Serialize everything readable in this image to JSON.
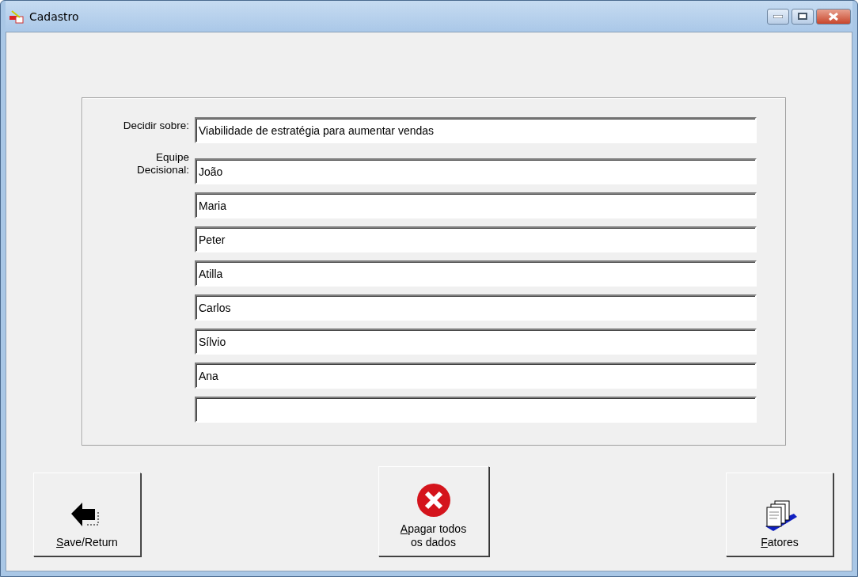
{
  "window": {
    "title": "Cadastro"
  },
  "decide": {
    "label": "Decidir sobre:",
    "value": "Viabilidade de estratégia para aumentar vendas"
  },
  "team": {
    "label": "Equipe Decisional:",
    "members": [
      {
        "value": "João"
      },
      {
        "value": "Maria"
      },
      {
        "value": "Peter"
      },
      {
        "value": "Atilla"
      },
      {
        "value": "Carlos"
      },
      {
        "value": "Sílvio"
      },
      {
        "value": "Ana"
      }
    ],
    "trailing_blank_field": true
  },
  "buttons": [
    {
      "kind": "back",
      "label": "Save/Return",
      "mnemonic_underlined": true
    },
    {
      "kind": "delete",
      "label": "Apagar todos os dados",
      "mnemonic_underlined": true
    },
    {
      "kind": "cards",
      "label": "Fatores",
      "mnemonic_underlined": true
    }
  ]
}
